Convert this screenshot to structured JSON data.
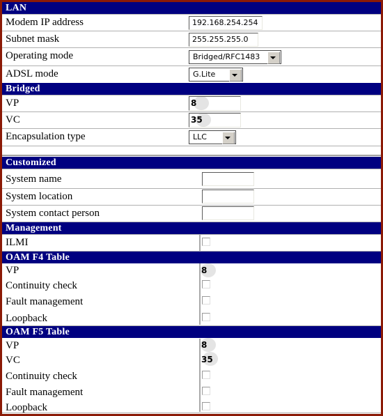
{
  "page": {
    "border_color": "#8b1a06",
    "header_bg": "#000080",
    "header_fg": "#ffffff"
  },
  "sections": {
    "lan": {
      "title": "LAN",
      "rows": {
        "modem_ip": {
          "label": "Modem IP address",
          "value": "192.168.254.254"
        },
        "subnet_mask": {
          "label": "Subnet mask",
          "value": "255.255.255.0"
        },
        "operating_mode": {
          "label": "Operating mode",
          "value": "Bridged/RFC1483"
        },
        "adsl_mode": {
          "label": "ADSL mode",
          "value": "G.Lite"
        }
      }
    },
    "bridged": {
      "title": "Bridged",
      "rows": {
        "vp": {
          "label": "VP",
          "value": "8"
        },
        "vc": {
          "label": "VC",
          "value": "35"
        },
        "encapsulation": {
          "label": "Encapsulation type",
          "value": "LLC"
        }
      }
    },
    "customized": {
      "title": "Customized",
      "rows": {
        "system_name": {
          "label": "System name",
          "value": "",
          "placeholder": ""
        },
        "system_location": {
          "label": "System location",
          "value": "",
          "placeholder": ""
        },
        "system_contact": {
          "label": "System contact person",
          "value": "",
          "placeholder": ""
        }
      }
    },
    "management": {
      "title": "Management",
      "rows": {
        "ilmi": {
          "label": "ILMI",
          "checked": false
        }
      }
    },
    "oam_f4": {
      "title": "OAM F4 Table",
      "rows": {
        "vp": {
          "label": "VP",
          "value": "8"
        },
        "continuity_check": {
          "label": "Continuity check",
          "checked": false
        },
        "fault_management": {
          "label": "Fault management",
          "checked": false
        },
        "loopback": {
          "label": "Loopback",
          "checked": false
        }
      }
    },
    "oam_f5": {
      "title": "OAM F5 Table",
      "rows": {
        "vp": {
          "label": "VP",
          "value": "8"
        },
        "vc": {
          "label": "VC",
          "value": "35"
        },
        "continuity_check": {
          "label": "Continuity check",
          "checked": false
        },
        "fault_management": {
          "label": "Fault management",
          "checked": false
        },
        "loopback": {
          "label": "Loopback",
          "checked": false
        }
      }
    }
  }
}
